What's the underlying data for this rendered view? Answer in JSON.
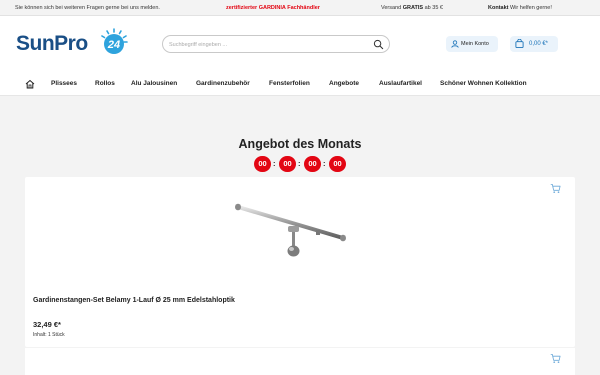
{
  "topbar": {
    "help_text": "Sie können sich bei weiteren Fragen gerne bei uns melden.",
    "certified_text": "zertifizierter GARDINIA Fachhändler",
    "shipping_prefix": "Versand ",
    "shipping_bold": "GRATIS",
    "shipping_suffix": " ab 35 €",
    "contact_bold": "Kontakt",
    "contact_text": " Wir helfen gerne!"
  },
  "header": {
    "logo_text": "SunPro",
    "logo_badge": "24",
    "search_placeholder": "Suchbegriff eingeben ...",
    "account_label": "Mein Konto",
    "cart_label": "0,00 €*"
  },
  "nav": {
    "items": [
      "Plissees",
      "Rollos",
      "Alu Jalousinen",
      "Gardinenzubehör",
      "Fensterfolien",
      "Angebote",
      "Auslaufartikel",
      "Schöner Wohnen Kollektion"
    ]
  },
  "offer": {
    "title": "Angebot des Monats",
    "countdown": [
      "00",
      "00",
      "00",
      "00"
    ],
    "separator": ":"
  },
  "product": {
    "title": "Gardinenstangen-Set Belamy 1-Lauf Ø 25 mm Edelstahloptik",
    "price": "32,49 €*",
    "unit": "Inhalt: 1 Stück"
  },
  "colors": {
    "brand_blue": "#1a4f86",
    "accent_red": "#e30613",
    "light_blue": "#eaf3fb"
  }
}
